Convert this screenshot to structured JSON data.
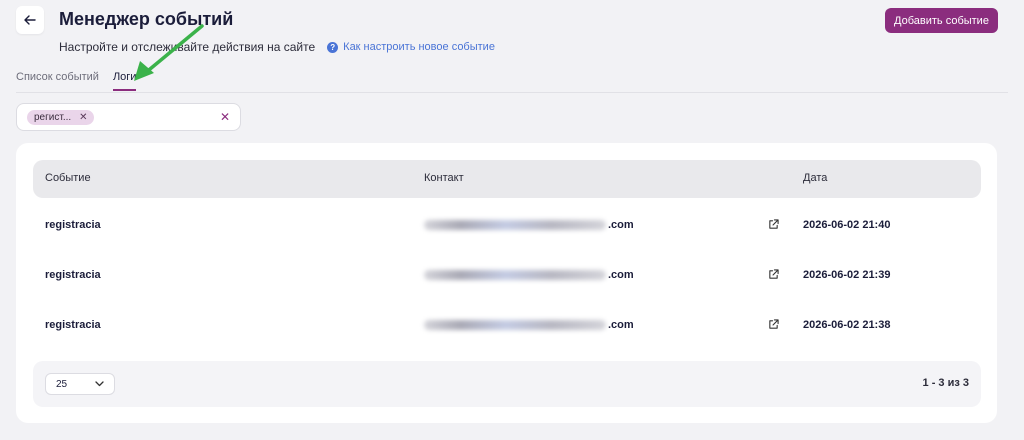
{
  "header": {
    "title": "Менеджер событий",
    "subtitle": "Настройте и отслеживайте действия на сайте",
    "help_link": "Как настроить новое событие",
    "add_button": "Добавить событие"
  },
  "tabs": [
    {
      "label": "Список событий",
      "active": false
    },
    {
      "label": "Логи",
      "active": true
    }
  ],
  "filter": {
    "chip_label": "регист..."
  },
  "table": {
    "columns": [
      "Событие",
      "Контакт",
      "Дата"
    ],
    "rows": [
      {
        "event": "registracia",
        "contact_suffix": ".com",
        "date": "2026-06-02 21:40"
      },
      {
        "event": "registracia",
        "contact_suffix": ".com",
        "date": "2026-06-02 21:39"
      },
      {
        "event": "registracia",
        "contact_suffix": ".com",
        "date": "2026-06-02 21:38"
      }
    ]
  },
  "pagination": {
    "page_size": "25",
    "range": "1 - 3 из 3"
  },
  "colors": {
    "accent": "#8b2d7e",
    "link": "#4a74d6",
    "annotation_arrow": "#3bb24a"
  }
}
